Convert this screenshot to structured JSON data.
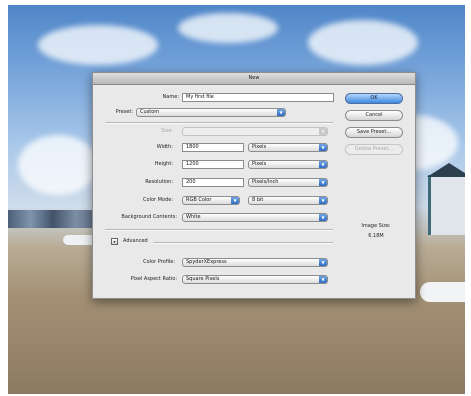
{
  "dialog": {
    "title": "New",
    "name_label": "Name:",
    "name_value": "My first file",
    "preset_label": "Preset:",
    "preset_value": "Custom",
    "size_label": "Size:",
    "size_value": "",
    "width_label": "Width:",
    "width_value": "1800",
    "width_unit": "Pixels",
    "height_label": "Height:",
    "height_value": "1200",
    "height_unit": "Pixels",
    "resolution_label": "Resolution:",
    "resolution_value": "200",
    "resolution_unit": "Pixels/Inch",
    "color_mode_label": "Color Mode:",
    "color_mode_value": "RGB Color",
    "bit_depth_value": "8 bit",
    "background_label": "Background Contents:",
    "background_value": "White",
    "advanced_label": "Advanced",
    "advanced_toggle": "▾",
    "color_profile_label": "Color Profile:",
    "color_profile_value": "SpyderXExpress",
    "pixel_aspect_label": "Pixel Aspect Ratio:",
    "pixel_aspect_value": "Square Pixels",
    "ok_label": "OK",
    "cancel_label": "Cancel",
    "save_preset_label": "Save Preset...",
    "delete_preset_label": "Delete Preset...",
    "image_size_label": "Image Size:",
    "image_size_value": "6.18M"
  },
  "colors": {
    "accent": "#3d87e0",
    "dialog_bg": "#e9e9e9"
  }
}
